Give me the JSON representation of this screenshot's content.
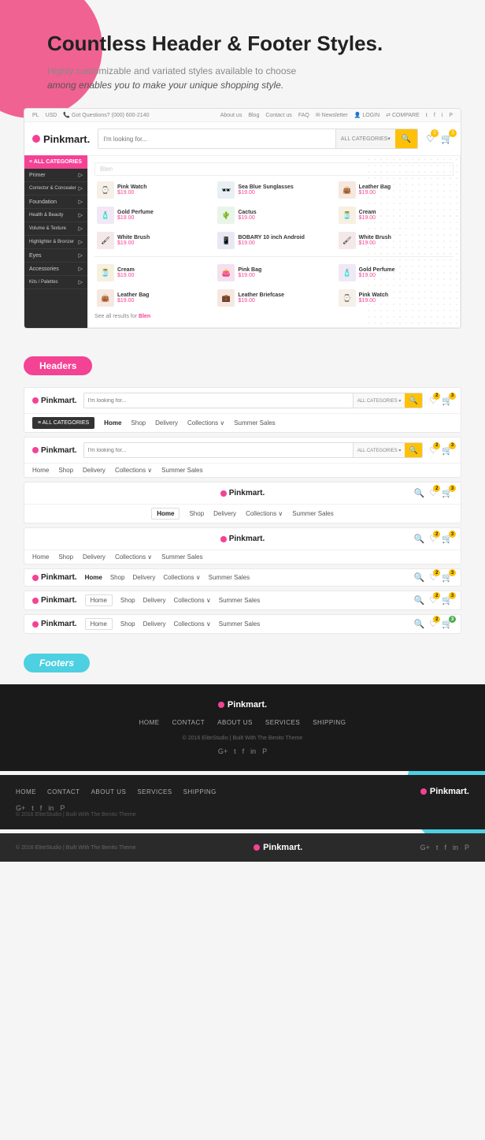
{
  "hero": {
    "title": "Countless Header & Footer Styles.",
    "subtitle": "Highly customizable and variated styles available to choose",
    "subtitle2": "among enables you to make your unique shopping style."
  },
  "brand": {
    "name": "Pinkmart.",
    "dot_color": "#f44294"
  },
  "topbar": {
    "currency": "USD",
    "phone_label": "Got Questions?",
    "phone": "(000) 600-2140",
    "links": [
      "About us",
      "Blog",
      "Contact us",
      "FAQ",
      "Newsletter"
    ],
    "account": "LOGIN",
    "compare": "COMPARE",
    "social": [
      "t",
      "f",
      "i",
      "p"
    ]
  },
  "search": {
    "placeholder": "I'm looking for...",
    "category_default": "ALL CATEGORIES",
    "search_icon": "🔍"
  },
  "sidebar_menu": {
    "all_categories_label": "≡  ALL CATEGORIES",
    "items": [
      {
        "label": "Primer",
        "has_arrow": true
      },
      {
        "label": "Corrector & Concealer",
        "has_arrow": true
      },
      {
        "label": "Foundation",
        "has_arrow": true
      },
      {
        "label": "Health & Beauty",
        "has_arrow": true
      },
      {
        "label": "Volume & Texture",
        "has_arrow": true
      },
      {
        "label": "Highlighter & Bronzer",
        "has_arrow": true
      },
      {
        "label": "Eyes",
        "has_arrow": true
      },
      {
        "label": "Accessories",
        "has_arrow": true
      },
      {
        "label": "Kits / Palettes",
        "has_arrow": true
      }
    ]
  },
  "dropdown_products": [
    {
      "name": "Pink Watch",
      "price": "$19.00",
      "thumb_class": "thumb-watch",
      "icon": "⌚"
    },
    {
      "name": "Sea Blue Sunglasses",
      "price": "$19.00",
      "thumb_class": "thumb-glasses",
      "icon": "🕶️"
    },
    {
      "name": "Leather Bag",
      "price": "$19.00",
      "thumb_class": "thumb-bag",
      "icon": "👜"
    },
    {
      "name": "Gold Perfume",
      "price": "$19.00",
      "thumb_class": "thumb-perfume",
      "icon": "🧴"
    },
    {
      "name": "Cactus",
      "price": "$19.00",
      "thumb_class": "thumb-cactus",
      "icon": "🌵"
    },
    {
      "name": "Cream",
      "price": "$19.00",
      "thumb_class": "thumb-cream",
      "icon": "🫙"
    },
    {
      "name": "White Brush",
      "price": "$19.00",
      "thumb_class": "thumb-brush",
      "icon": "🖌️"
    },
    {
      "name": "BOBARY 10 inch Android",
      "price": "$19.00",
      "thumb_class": "thumb-tablet",
      "icon": "📱"
    },
    {
      "name": "White Brush",
      "price": "$19.00",
      "thumb_class": "thumb-brush",
      "icon": "🖌️"
    },
    {
      "name": "Cream",
      "price": "$19.00",
      "thumb_class": "thumb-cream",
      "icon": "🫙"
    },
    {
      "name": "Pink Bag",
      "price": "$19.00",
      "thumb_class": "thumb-pinkbag",
      "icon": "👛"
    },
    {
      "name": "Gold Perfume",
      "price": "$19.00",
      "thumb_class": "thumb-perfume",
      "icon": "🧴"
    },
    {
      "name": "Leather Bag",
      "price": "$19.00",
      "thumb_class": "thumb-bag",
      "icon": "👜"
    },
    {
      "name": "Leather Briefcase",
      "price": "$19.00",
      "thumb_class": "thumb-bag",
      "icon": "💼"
    },
    {
      "name": "Pink Watch",
      "price": "$19.00",
      "thumb_class": "thumb-watch",
      "icon": "⌚"
    }
  ],
  "search_results_text": "See all results for",
  "search_results_term": "Blen",
  "sections": {
    "headers_label": "Headers",
    "footers_label": "Footers"
  },
  "nav_items": [
    "Home",
    "Shop",
    "Delivery",
    "Collections ∨",
    "Summer Sales"
  ],
  "headers": [
    {
      "id": 1,
      "has_all_cat": true,
      "all_cat_dark": true,
      "nav_home_active": true
    },
    {
      "id": 2,
      "has_all_cat": false,
      "nav_home_active": false
    },
    {
      "id": 3,
      "centered_logo": true
    },
    {
      "id": 4,
      "centered_logo": true,
      "no_search": true
    },
    {
      "id": 5,
      "inline_logo_nav": true
    },
    {
      "id": 6,
      "inline_logo_nav": true
    },
    {
      "id": 7,
      "inline_logo_nav": true,
      "badge_green": true
    }
  ],
  "footers": [
    {
      "id": 1,
      "style": "dark_centered",
      "nav": [
        "HOME",
        "CONTACT",
        "ABOUT US",
        "SERVICES",
        "SHIPPING"
      ],
      "copy": "© 2016 EliteStudio | Built With The Benito Theme",
      "social": [
        "G+",
        "t",
        "f",
        "in",
        "P"
      ]
    },
    {
      "id": 2,
      "style": "dark_split",
      "nav": [
        "HOME",
        "CONTACT",
        "ABOUT US",
        "SERVICES",
        "SHIPPING"
      ],
      "copy": "© 2016 EliteStudio | Built With The Benito Theme",
      "social": [
        "G+",
        "t",
        "f",
        "in",
        "P"
      ]
    },
    {
      "id": 3,
      "style": "minimal",
      "copy": "© 2016 EliteStudio | Built With The Benito Theme",
      "social": [
        "G+",
        "t",
        "f",
        "in",
        "P"
      ]
    }
  ],
  "icons": {
    "search": "🔍",
    "heart": "♡",
    "cart": "🛒",
    "user": "👤",
    "compare": "⇄",
    "logo_symbol": "📌"
  }
}
